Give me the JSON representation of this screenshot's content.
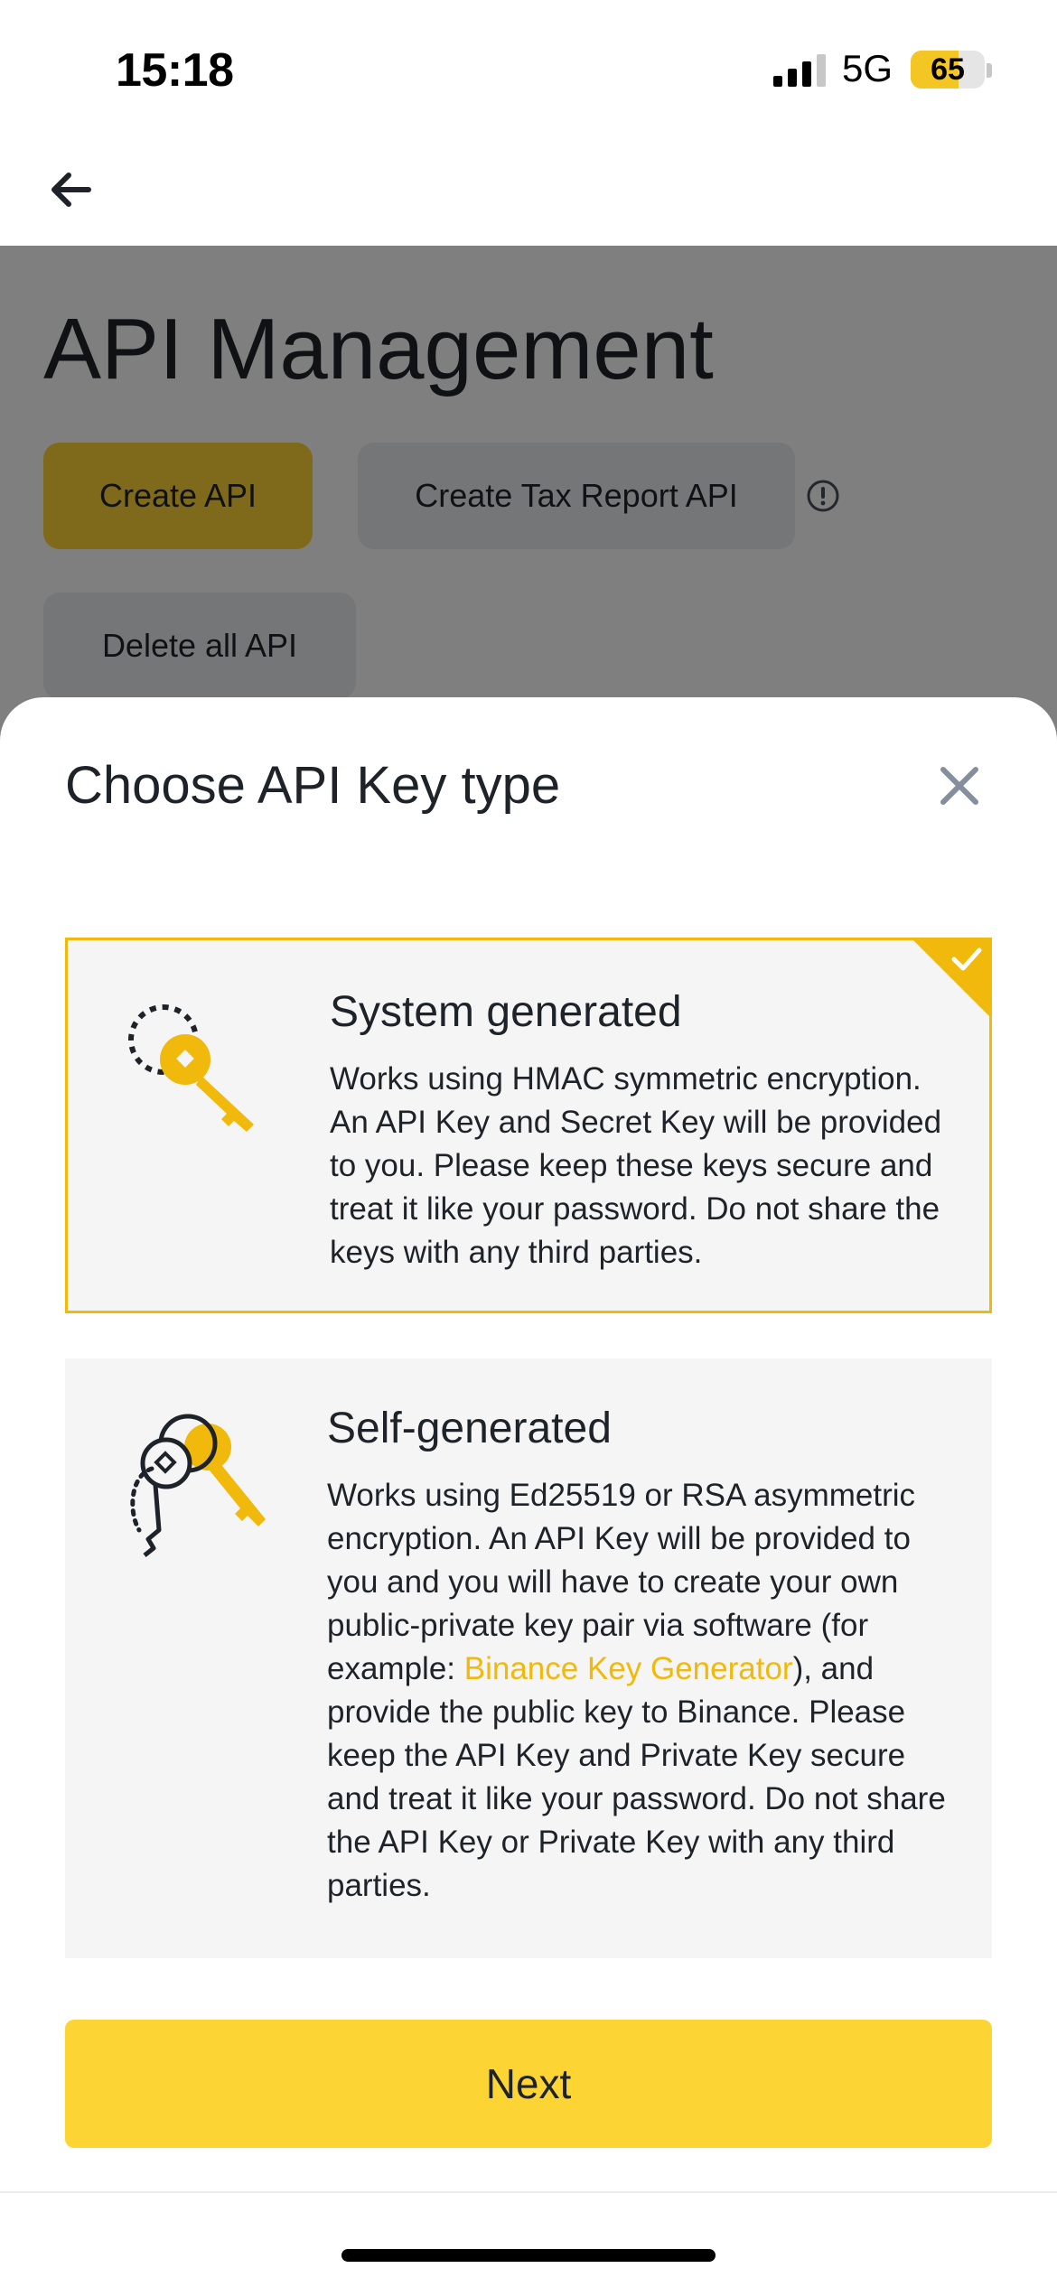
{
  "status_bar": {
    "time": "15:18",
    "network": "5G",
    "battery": "65",
    "battery_level": 0.65
  },
  "header": {
    "back_icon": "arrow-left-icon"
  },
  "background_page": {
    "title": "API Management",
    "buttons": {
      "create_api": "Create API",
      "create_tax_report_api": "Create Tax Report API",
      "delete_all_api": "Delete all API"
    },
    "info_icon": "info-circle-icon"
  },
  "sheet": {
    "title": "Choose API Key type",
    "close_icon": "close-x-icon",
    "options": [
      {
        "id": "system",
        "title": "System generated",
        "description": "Works using HMAC symmetric encryption. An API Key and Secret Key will be provided to you. Please keep these keys secure and treat it like your password. Do not share the keys with any third parties.",
        "selected": true,
        "icon": "key-icon"
      },
      {
        "id": "self",
        "title": "Self-generated",
        "description_before_link": "Works using Ed25519 or RSA asymmetric encryption. An API Key will be provided to you and you will have to create your own public-private key pair via software (for example: ",
        "link_text": "Binance Key Generator",
        "description_after_link": "), and provide the public key to Binance. Please keep the API Key and Private Key secure and treat it like your password. Do not share the API Key or Private Key with any third parties.",
        "selected": false,
        "icon": "key-pair-icon"
      }
    ],
    "next_button": "Next"
  },
  "colors": {
    "accent": "#fcd535",
    "accent_dark": "#f0b90b",
    "text": "#1e2329",
    "card_bg": "#f5f5f5"
  }
}
